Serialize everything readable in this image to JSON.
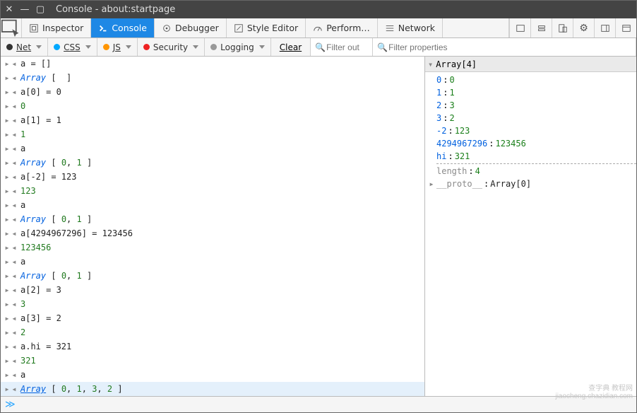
{
  "title": "Console - about:startpage",
  "tabs": {
    "inspector": "Inspector",
    "console": "Console",
    "debugger": "Debugger",
    "style": "Style Editor",
    "perf": "Perform…",
    "network": "Network"
  },
  "filters": {
    "net": "Net",
    "css": "CSS",
    "js": "JS",
    "security": "Security",
    "logging": "Logging",
    "clear": "Clear",
    "filter_output_ph": "Filter out",
    "filter_props_ph": "Filter properties"
  },
  "console_rows": [
    {
      "dir": "in",
      "segs": [
        {
          "t": "a = []",
          "c": "pun"
        }
      ]
    },
    {
      "dir": "out",
      "segs": [
        {
          "t": "Array",
          "c": "str"
        },
        {
          "t": " [  ]",
          "c": "pun"
        }
      ]
    },
    {
      "dir": "in",
      "segs": [
        {
          "t": "a[0] = 0",
          "c": "pun"
        }
      ]
    },
    {
      "dir": "out",
      "segs": [
        {
          "t": "0",
          "c": "num"
        }
      ]
    },
    {
      "dir": "in",
      "segs": [
        {
          "t": "a[1] = 1",
          "c": "pun"
        }
      ]
    },
    {
      "dir": "out",
      "segs": [
        {
          "t": "1",
          "c": "num"
        }
      ]
    },
    {
      "dir": "in",
      "segs": [
        {
          "t": "a",
          "c": "pun"
        }
      ]
    },
    {
      "dir": "out",
      "segs": [
        {
          "t": "Array",
          "c": "str"
        },
        {
          "t": " [ ",
          "c": "pun"
        },
        {
          "t": "0",
          "c": "num"
        },
        {
          "t": ", ",
          "c": "pun"
        },
        {
          "t": "1",
          "c": "num"
        },
        {
          "t": " ]",
          "c": "pun"
        }
      ]
    },
    {
      "dir": "in",
      "segs": [
        {
          "t": "a[-2] = 123",
          "c": "pun"
        }
      ]
    },
    {
      "dir": "out",
      "segs": [
        {
          "t": "123",
          "c": "num"
        }
      ]
    },
    {
      "dir": "in",
      "segs": [
        {
          "t": "a",
          "c": "pun"
        }
      ]
    },
    {
      "dir": "out",
      "segs": [
        {
          "t": "Array",
          "c": "str"
        },
        {
          "t": " [ ",
          "c": "pun"
        },
        {
          "t": "0",
          "c": "num"
        },
        {
          "t": ", ",
          "c": "pun"
        },
        {
          "t": "1",
          "c": "num"
        },
        {
          "t": " ]",
          "c": "pun"
        }
      ]
    },
    {
      "dir": "in",
      "segs": [
        {
          "t": "a[4294967296] = 123456",
          "c": "pun"
        }
      ]
    },
    {
      "dir": "out",
      "segs": [
        {
          "t": "123456",
          "c": "num"
        }
      ]
    },
    {
      "dir": "in",
      "segs": [
        {
          "t": "a",
          "c": "pun"
        }
      ]
    },
    {
      "dir": "out",
      "segs": [
        {
          "t": "Array",
          "c": "str"
        },
        {
          "t": " [ ",
          "c": "pun"
        },
        {
          "t": "0",
          "c": "num"
        },
        {
          "t": ", ",
          "c": "pun"
        },
        {
          "t": "1",
          "c": "num"
        },
        {
          "t": " ]",
          "c": "pun"
        }
      ]
    },
    {
      "dir": "in",
      "segs": [
        {
          "t": "a[2] = 3",
          "c": "pun"
        }
      ]
    },
    {
      "dir": "out",
      "segs": [
        {
          "t": "3",
          "c": "num"
        }
      ]
    },
    {
      "dir": "in",
      "segs": [
        {
          "t": "a[3] = 2",
          "c": "pun"
        }
      ]
    },
    {
      "dir": "out",
      "segs": [
        {
          "t": "2",
          "c": "num"
        }
      ]
    },
    {
      "dir": "in",
      "segs": [
        {
          "t": "a.hi = 321",
          "c": "pun"
        }
      ]
    },
    {
      "dir": "out",
      "segs": [
        {
          "t": "321",
          "c": "num"
        }
      ]
    },
    {
      "dir": "in",
      "segs": [
        {
          "t": "a",
          "c": "pun"
        }
      ]
    },
    {
      "dir": "out",
      "sel": true,
      "segs": [
        {
          "t": "Array",
          "c": "str under"
        },
        {
          "t": " [ ",
          "c": "pun"
        },
        {
          "t": "0",
          "c": "num"
        },
        {
          "t": ", ",
          "c": "pun"
        },
        {
          "t": "1",
          "c": "num"
        },
        {
          "t": ", ",
          "c": "pun"
        },
        {
          "t": "3",
          "c": "num"
        },
        {
          "t": ", ",
          "c": "pun"
        },
        {
          "t": "2",
          "c": "num"
        },
        {
          "t": " ]",
          "c": "pun"
        }
      ]
    }
  ],
  "right": {
    "header_label": "Array[4]",
    "props": [
      {
        "k": "0",
        "v": "0",
        "vt": "num"
      },
      {
        "k": "1",
        "v": "1",
        "vt": "num"
      },
      {
        "k": "2",
        "v": "3",
        "vt": "num"
      },
      {
        "k": "3",
        "v": "2",
        "vt": "num"
      },
      {
        "k": "-2",
        "v": "123",
        "vt": "num"
      },
      {
        "k": "4294967296",
        "v": "123456",
        "vt": "num"
      },
      {
        "k": "hi",
        "v": "321",
        "vt": "num"
      }
    ],
    "length_k": "length",
    "length_v": "4",
    "proto_k": "__proto__",
    "proto_v": "Array[0]"
  },
  "watermark_l1": "查字典 教程网",
  "watermark_l2": "jiaocheng.chazidian.com"
}
